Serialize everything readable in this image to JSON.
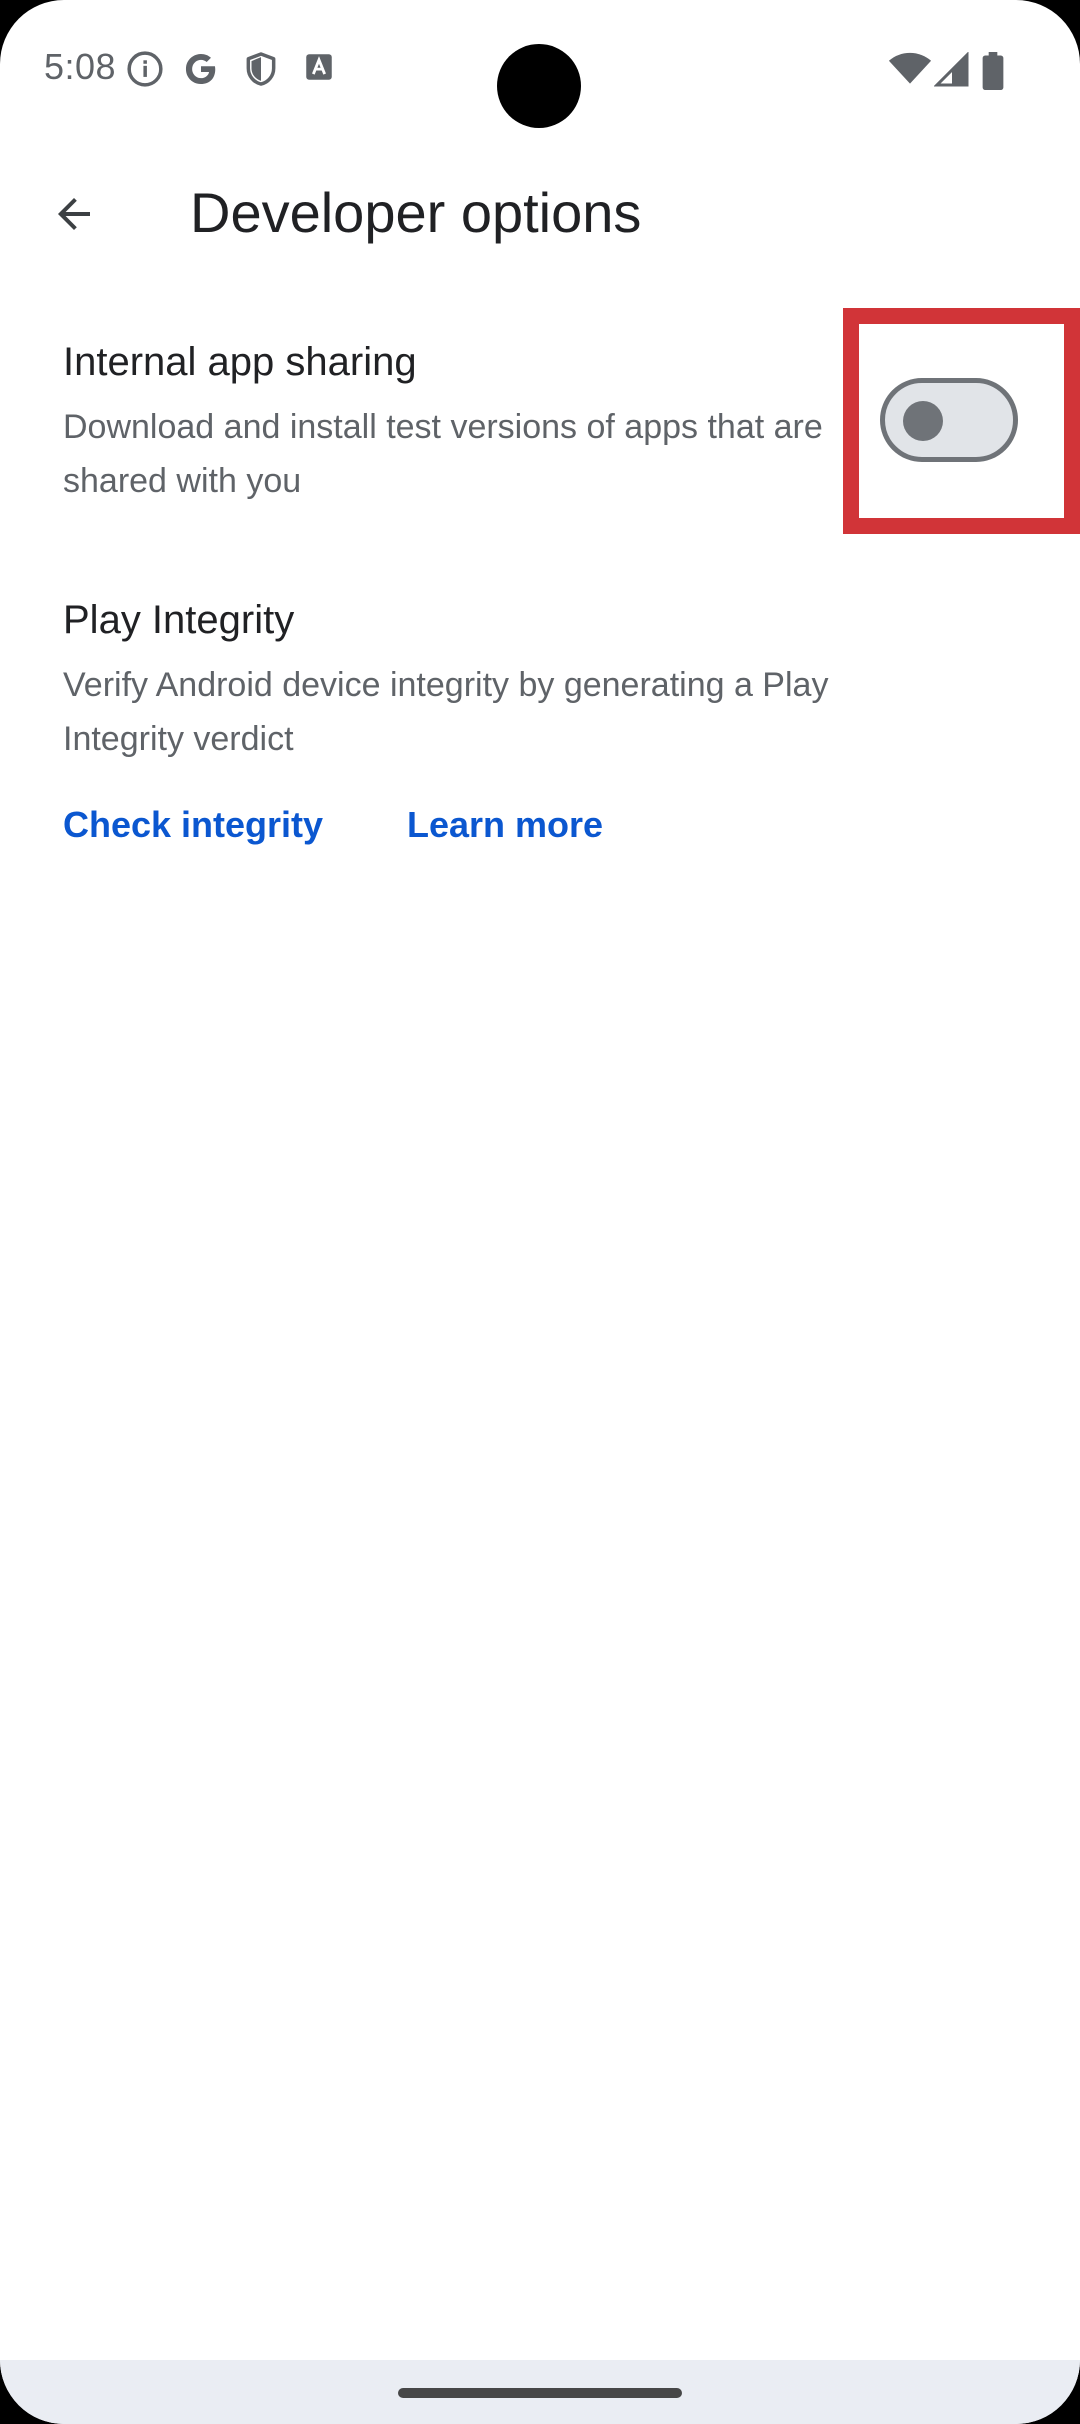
{
  "status_bar": {
    "time": "5:08",
    "left_icons": [
      "info-icon",
      "google-icon",
      "shield-icon",
      "font-icon"
    ],
    "right_icons": [
      "wifi-icon",
      "signal-icon",
      "battery-icon"
    ]
  },
  "app_bar": {
    "title": "Developer options",
    "back_icon": "arrow-back-icon"
  },
  "settings": {
    "internal_app_sharing": {
      "title": "Internal app sharing",
      "description": "Download and install test versions of apps that are shared with you",
      "toggle_on": false
    },
    "play_integrity": {
      "title": "Play Integrity",
      "description": "Verify Android device integrity by generating a Play Integrity verdict",
      "check_label": "Check integrity",
      "learn_more_label": "Learn more"
    }
  },
  "colors": {
    "accent": "#0b57d0",
    "highlight": "#d13438",
    "title_text": "#202124",
    "secondary_text": "#5f6368"
  }
}
